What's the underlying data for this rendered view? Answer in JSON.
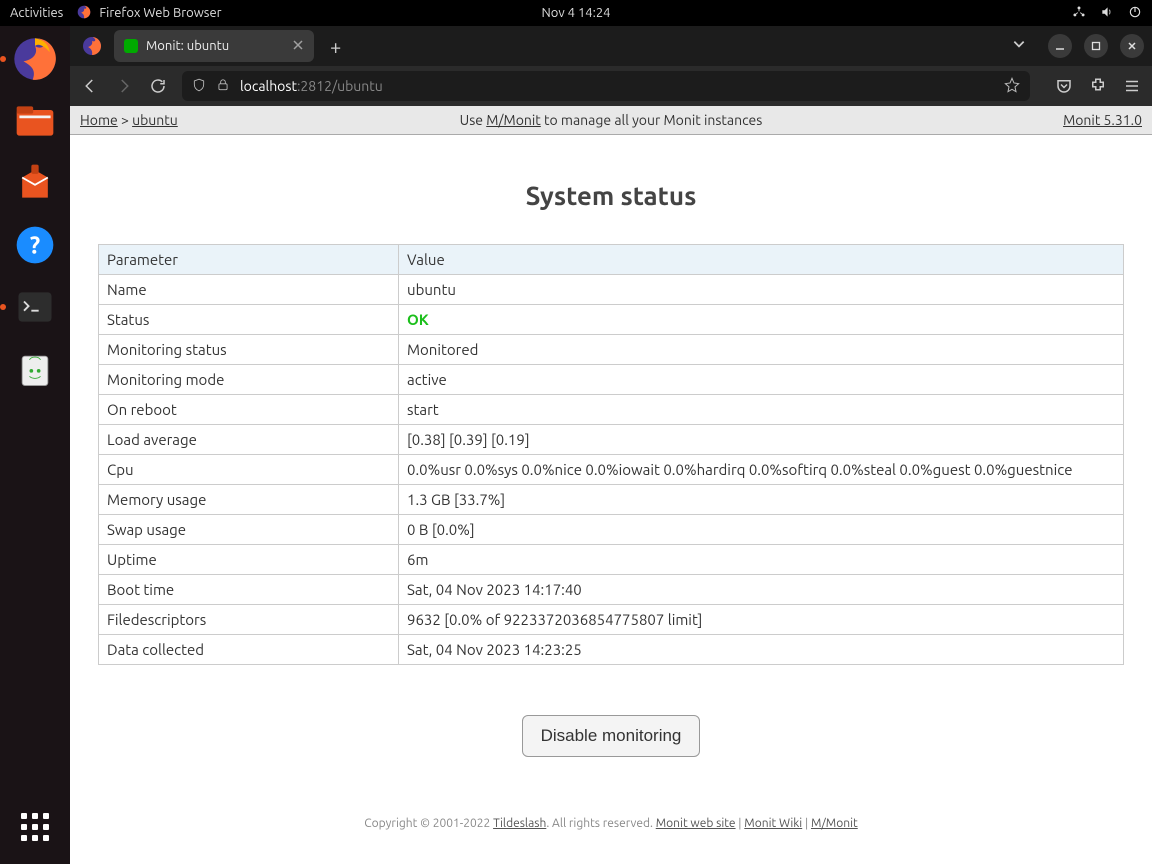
{
  "topbar": {
    "activities": "Activities",
    "app_label": "Firefox Web Browser",
    "clock": "Nov 4  14:24"
  },
  "tab": {
    "title": "Monit: ubuntu"
  },
  "url": {
    "host": "localhost",
    "port": ":2812",
    "path": "/ubuntu"
  },
  "header": {
    "home": "Home",
    "sep": " > ",
    "crumb": "ubuntu",
    "promo_pre": "Use ",
    "promo_link": "M/Monit",
    "promo_post": " to manage all your Monit instances",
    "version": "Monit 5.31.0"
  },
  "title": "System status",
  "table": {
    "header_param": "Parameter",
    "header_value": "Value",
    "rows": [
      {
        "param": "Name",
        "value": "ubuntu"
      },
      {
        "param": "Status",
        "value": "OK",
        "ok": true
      },
      {
        "param": "Monitoring status",
        "value": "Monitored"
      },
      {
        "param": "Monitoring mode",
        "value": "active"
      },
      {
        "param": "On reboot",
        "value": "start"
      },
      {
        "param": "Load average",
        "value": "[0.38] [0.39] [0.19]"
      },
      {
        "param": "Cpu",
        "value": "0.0%usr 0.0%sys 0.0%nice 0.0%iowait 0.0%hardirq 0.0%softirq 0.0%steal 0.0%guest 0.0%guestnice"
      },
      {
        "param": "Memory usage",
        "value": "1.3 GB [33.7%]"
      },
      {
        "param": "Swap usage",
        "value": "0 B [0.0%]"
      },
      {
        "param": "Uptime",
        "value": "6m"
      },
      {
        "param": "Boot time",
        "value": "Sat, 04 Nov 2023 14:17:40"
      },
      {
        "param": "Filedescriptors",
        "value": "9632 [0.0% of 9223372036854775807 limit]"
      },
      {
        "param": "Data collected",
        "value": "Sat, 04 Nov 2023 14:23:25"
      }
    ]
  },
  "action": {
    "disable": "Disable monitoring"
  },
  "footer": {
    "copyright": "Copyright © 2001-2022 ",
    "tildeslash": "Tildeslash",
    "rights": ". All rights reserved.   ",
    "link1": "Monit web site",
    "link2": "Monit Wiki",
    "link3": "M/Monit"
  }
}
